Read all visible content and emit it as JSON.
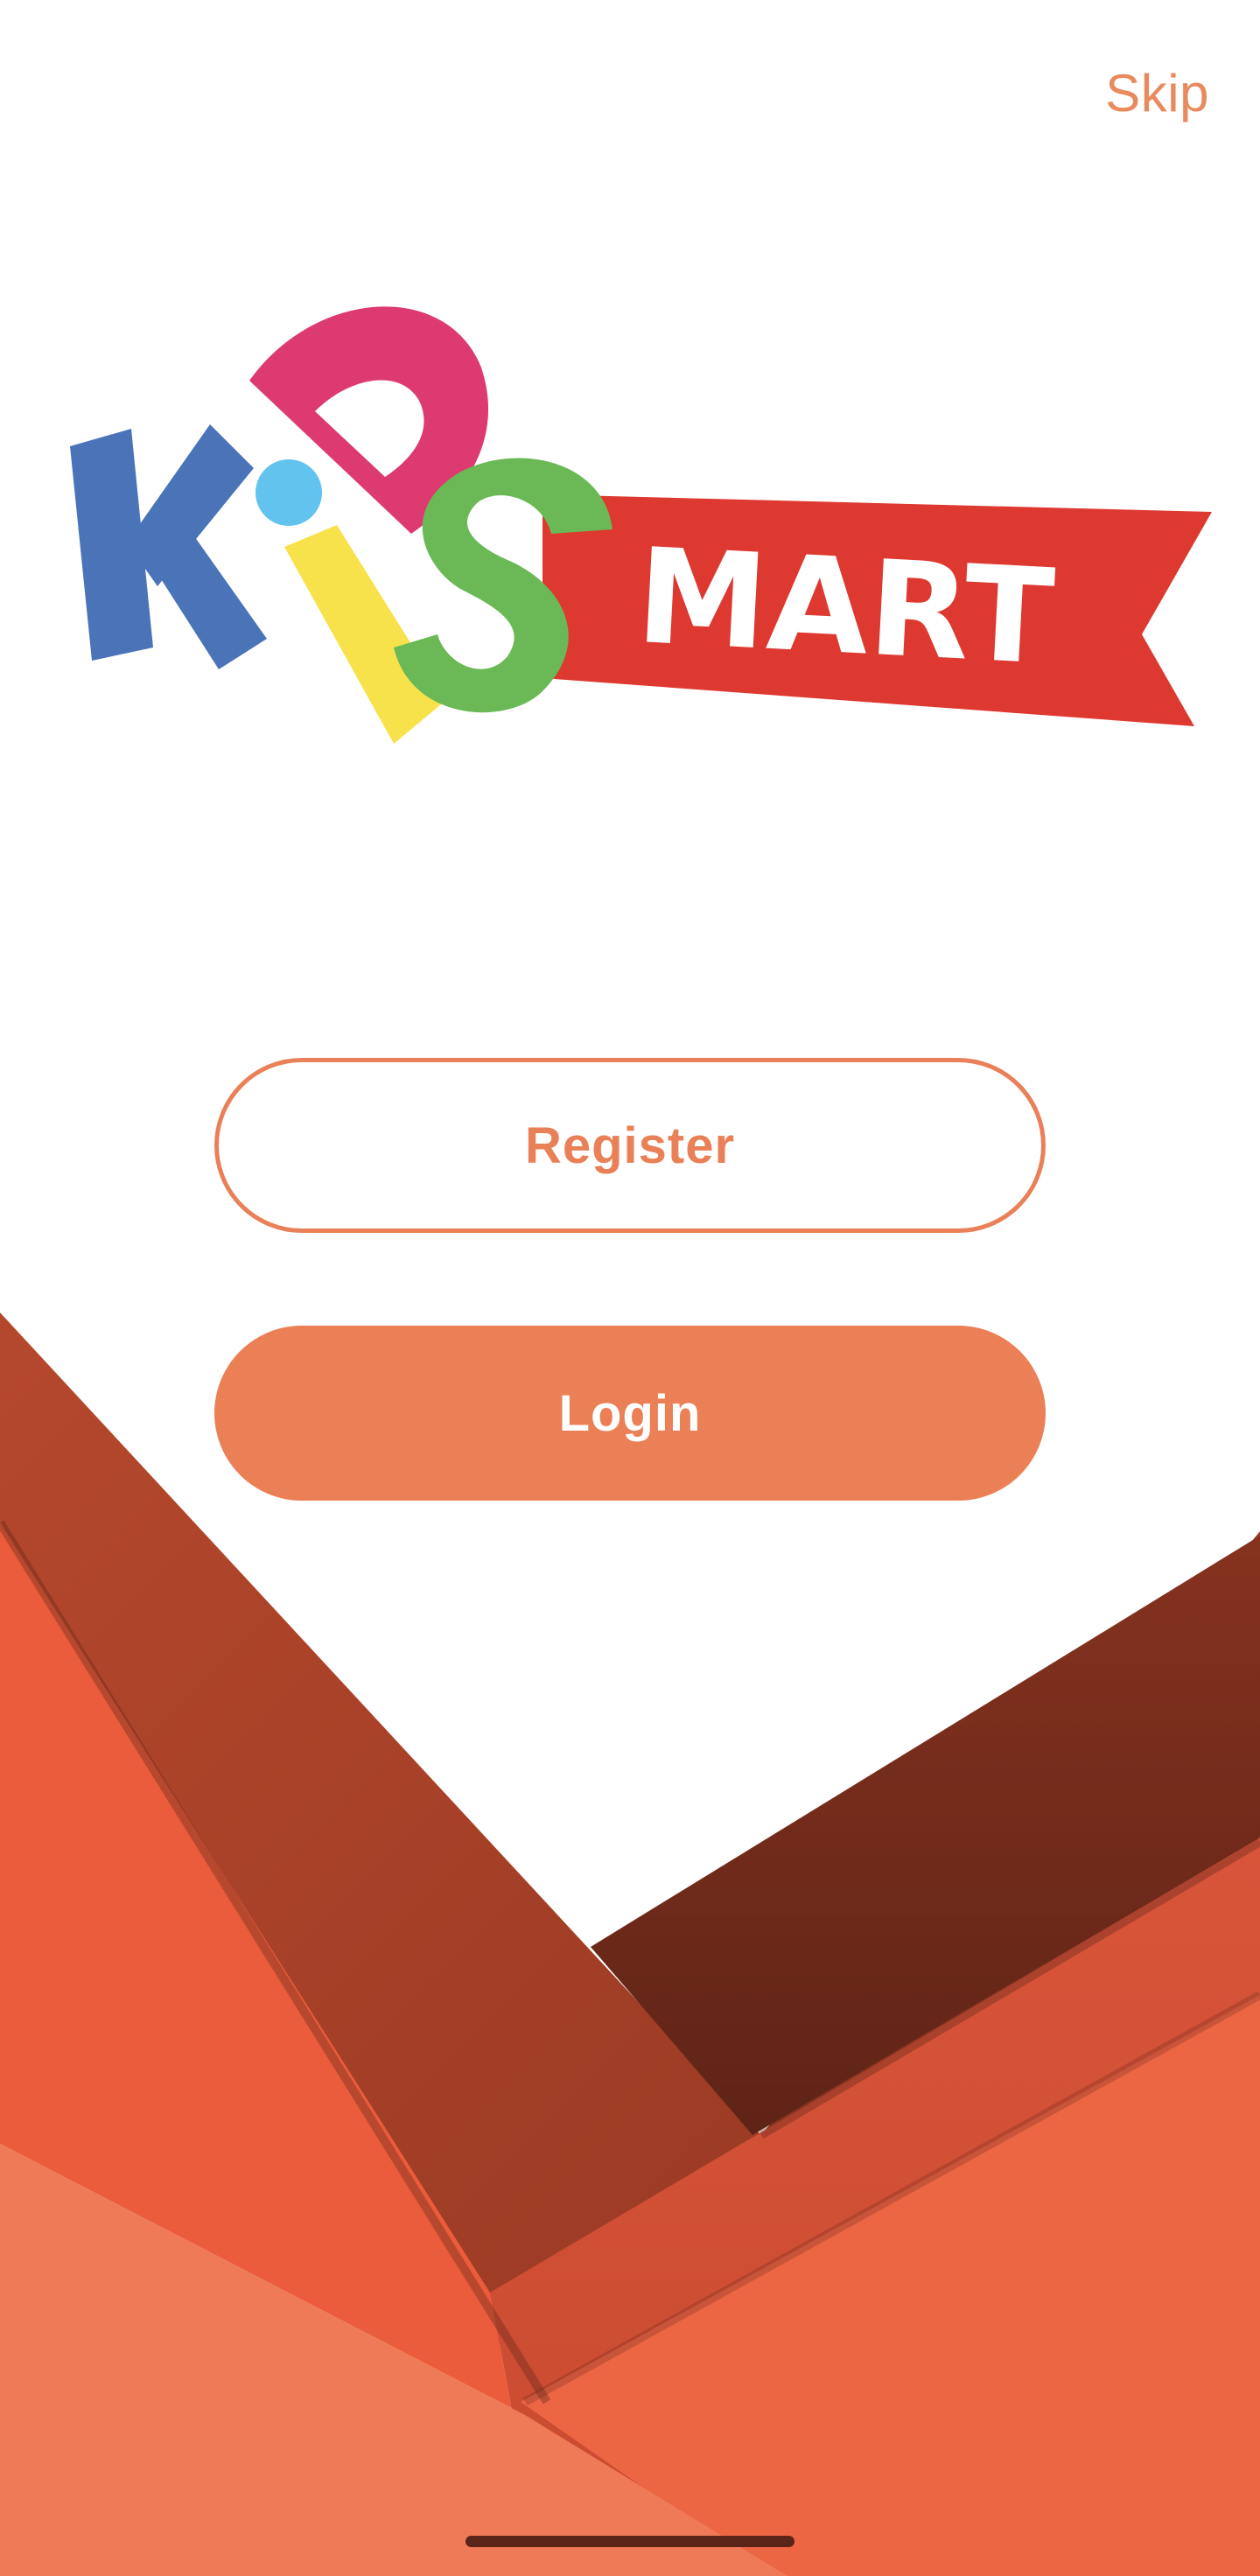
{
  "header": {
    "skip_label": "Skip"
  },
  "logo": {
    "letters_kids": [
      "K",
      "I",
      "D",
      "S"
    ],
    "banner_text": "MART",
    "colors": {
      "k": "#4B74B8",
      "i_dot": "#62C3EE",
      "i_stem": "#F7E24B",
      "d": "#DD3A72",
      "s": "#6AB956",
      "banner": "#DE3930",
      "banner_text": "#FFFFFF"
    }
  },
  "actions": {
    "register_label": "Register",
    "login_label": "Login"
  },
  "theme": {
    "accent": "#EB7F55",
    "background": "#FFFFFF",
    "shapes": [
      "#AE4329",
      "#83301F",
      "#EA5C3B",
      "#EC7A56",
      "#ED6644",
      "#D45233"
    ]
  }
}
